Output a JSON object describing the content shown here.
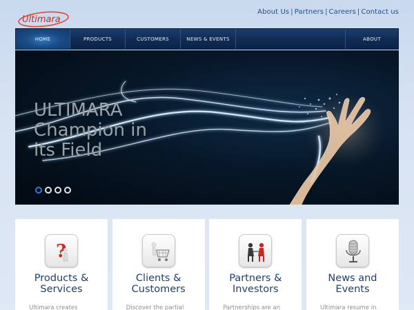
{
  "brand": {
    "logo_text": "Ultimara"
  },
  "top_links": [
    "About Us",
    "Partners",
    "Careers",
    "Contact us"
  ],
  "nav": {
    "home": "HOME",
    "products": "PRODUCTS",
    "customers": "CUSTOMERS",
    "news": "NEWS & EVENTS",
    "about": "ABOUT"
  },
  "hero": {
    "line1": "ULTIMARA",
    "line2": "Champion in",
    "line3": "its Field",
    "slides": 4,
    "active_slide": 1
  },
  "cards": [
    {
      "icon": "question-mark-icon",
      "title_1": "Products &",
      "title_2": "Services",
      "desc": "Ultimara creates"
    },
    {
      "icon": "shopping-cart-icon",
      "title_1": "Clients &",
      "title_2": "Customers",
      "desc": "Discover the partial"
    },
    {
      "icon": "handshake-icon",
      "title_1": "Partners &",
      "title_2": "Investors",
      "desc": "Partnerships are an"
    },
    {
      "icon": "microphone-icon",
      "title_1": "News and",
      "title_2": "Events",
      "desc": "Ultimara resume in"
    }
  ]
}
